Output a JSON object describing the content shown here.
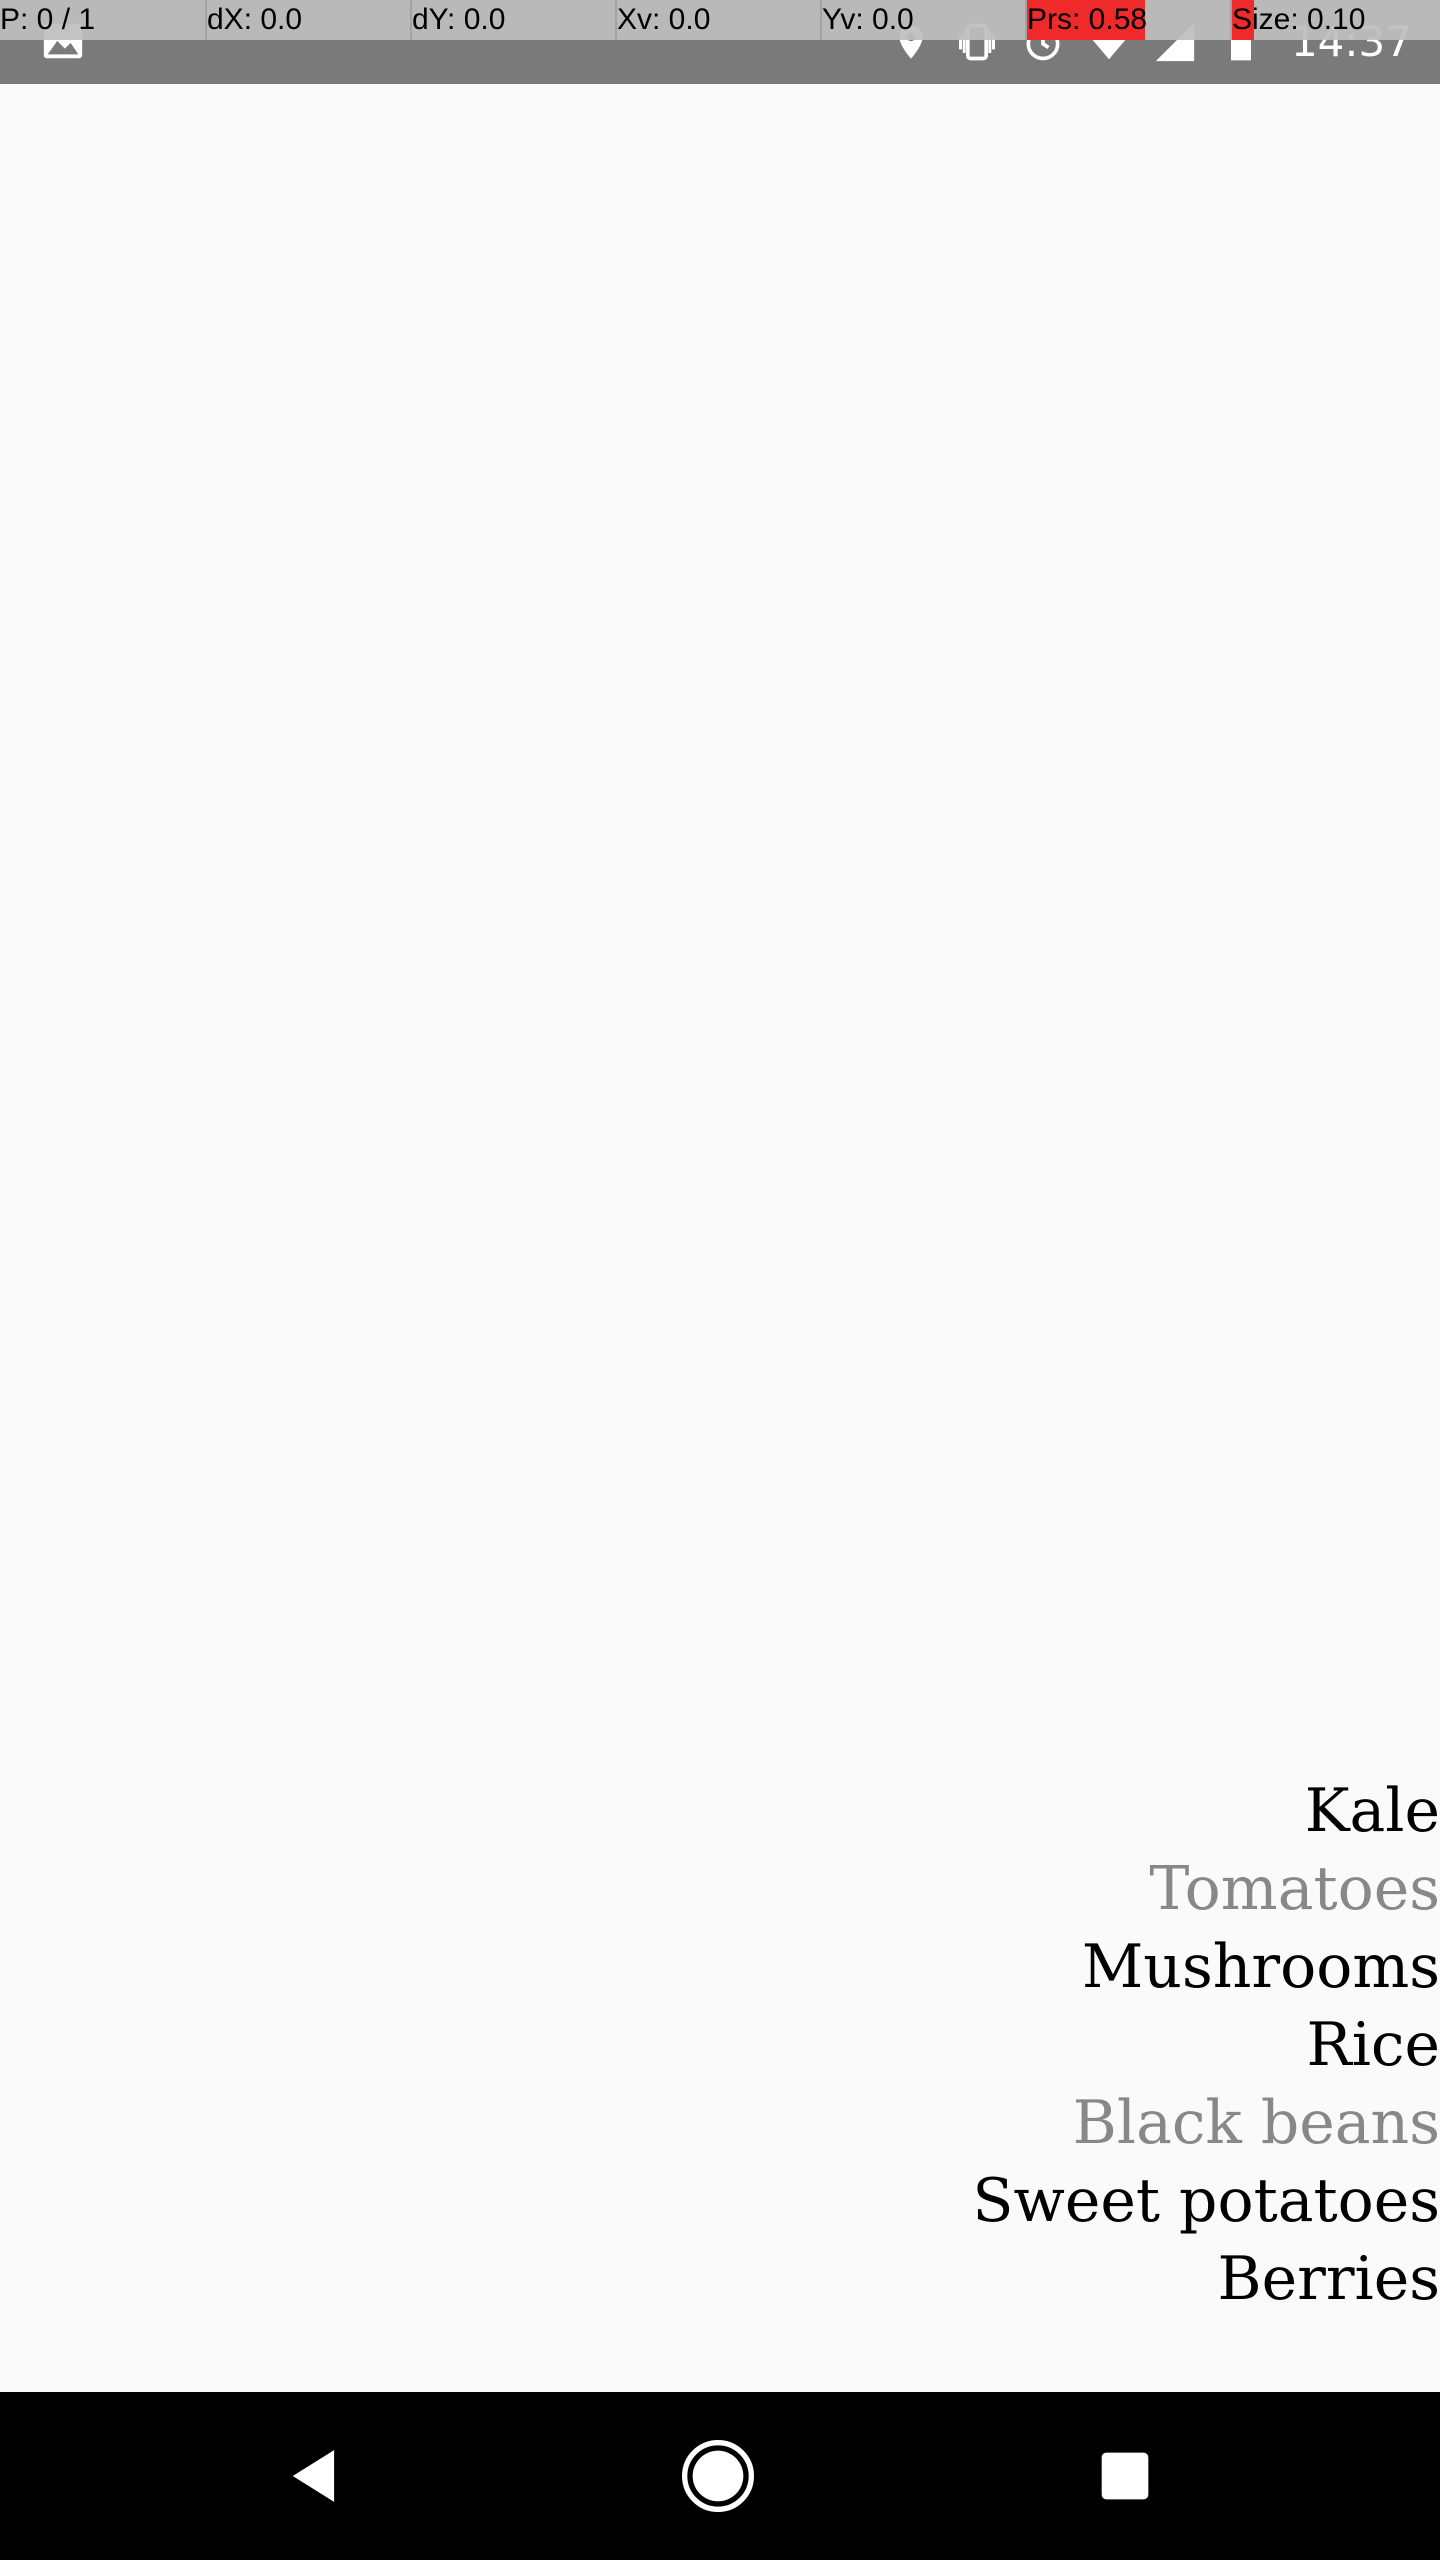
{
  "status_bar": {
    "time": "14:37",
    "icons": [
      "gallery-icon",
      "location-icon",
      "vibrate-icon",
      "alarm-icon",
      "wifi-icon",
      "signal-icon",
      "battery-icon"
    ]
  },
  "pointer_overlay": {
    "p": "P: 0 / 1",
    "dx": "dX: 0.0",
    "dy": "dY: 0.0",
    "xv": "Xv: 0.0",
    "yv": "Yv: 0.0",
    "prs": "Prs: 0.58",
    "size": "Size: 0.10"
  },
  "items": [
    {
      "label": "Kale",
      "done": false
    },
    {
      "label": "Tomatoes",
      "done": true
    },
    {
      "label": "Mushrooms",
      "done": false
    },
    {
      "label": "Rice",
      "done": false
    },
    {
      "label": "Black beans",
      "done": true
    },
    {
      "label": "Sweet potatoes",
      "done": false
    },
    {
      "label": "Berries",
      "done": false
    }
  ],
  "add_button": {
    "label": "+"
  },
  "nav_bar": {
    "icons": [
      "back-icon",
      "home-icon",
      "recents-icon"
    ]
  },
  "colors": {
    "background": "#fafafa",
    "status_bar": "#7a7a7a",
    "item_active": "#000000",
    "item_done": "#888888",
    "nav_bar": "#000000",
    "overlay_highlight": "#ee2a2a"
  }
}
